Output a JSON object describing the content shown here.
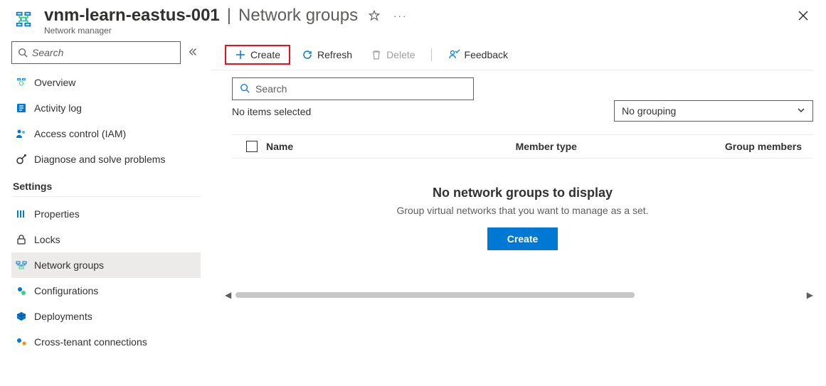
{
  "header": {
    "resource_name": "vnm-learn-eastus-001",
    "page_title": "Network groups",
    "subtitle": "Network manager"
  },
  "sidebar": {
    "search_placeholder": "Search",
    "items": [
      {
        "label": "Overview",
        "icon": "overview-icon"
      },
      {
        "label": "Activity log",
        "icon": "activity-log-icon"
      },
      {
        "label": "Access control (IAM)",
        "icon": "access-control-icon"
      },
      {
        "label": "Diagnose and solve problems",
        "icon": "diagnose-icon"
      }
    ],
    "settings_label": "Settings",
    "settings_items": [
      {
        "label": "Properties",
        "icon": "properties-icon"
      },
      {
        "label": "Locks",
        "icon": "locks-icon"
      },
      {
        "label": "Network groups",
        "icon": "network-groups-icon",
        "active": true
      },
      {
        "label": "Configurations",
        "icon": "configurations-icon"
      },
      {
        "label": "Deployments",
        "icon": "deployments-icon"
      },
      {
        "label": "Cross-tenant connections",
        "icon": "cross-tenant-icon"
      }
    ]
  },
  "toolbar": {
    "create": "Create",
    "refresh": "Refresh",
    "delete": "Delete",
    "feedback": "Feedback"
  },
  "content": {
    "search_placeholder": "Search",
    "selection_text": "No items selected",
    "grouping_value": "No grouping",
    "columns": {
      "name": "Name",
      "member_type": "Member type",
      "group_members": "Group members"
    },
    "empty_title": "No network groups to display",
    "empty_subtitle": "Group virtual networks that you want to manage as a set.",
    "empty_cta": "Create"
  }
}
